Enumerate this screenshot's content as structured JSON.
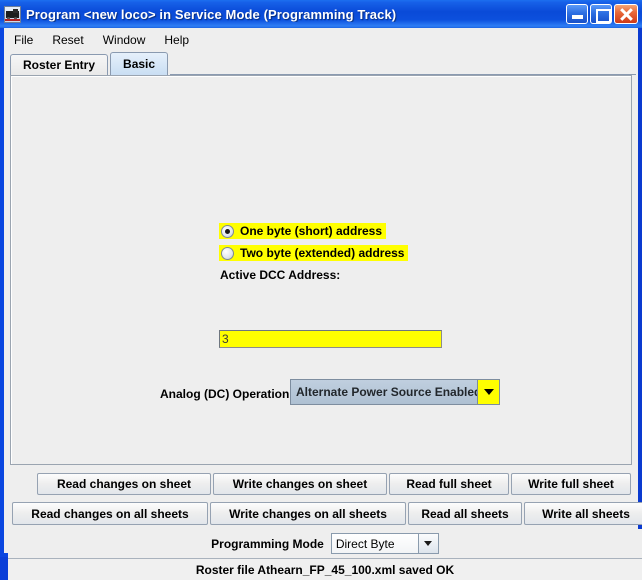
{
  "window": {
    "title": "Program <new loco> in Service Mode (Programming Track)",
    "icon": "locomotive-icon",
    "minimize_label": "",
    "maximize_label": "",
    "close_label": ""
  },
  "menubar": {
    "items": [
      {
        "label": "File"
      },
      {
        "label": "Reset"
      },
      {
        "label": "Window"
      },
      {
        "label": "Help"
      }
    ]
  },
  "tabs": [
    {
      "label": "Roster Entry",
      "selected": false
    },
    {
      "label": "Basic",
      "selected": true
    }
  ],
  "basic_panel": {
    "address_mode": {
      "options": [
        {
          "label": "One byte (short) address",
          "checked": true
        },
        {
          "label": "Two byte (extended) address",
          "checked": false
        }
      ]
    },
    "active_dcc_address": {
      "label": "Active DCC Address:",
      "value": "3",
      "placeholder": ""
    },
    "analog_operation": {
      "label": "Analog (DC) Operation",
      "value": "Alternate Power Source Enabled"
    }
  },
  "sheet_buttons": [
    {
      "label": "Read changes on sheet"
    },
    {
      "label": "Write changes on sheet"
    },
    {
      "label": "Read full sheet"
    },
    {
      "label": "Write full sheet"
    }
  ],
  "all_sheet_buttons": [
    {
      "label": "Read changes on all sheets"
    },
    {
      "label": "Write changes on all sheets"
    },
    {
      "label": "Read all sheets"
    },
    {
      "label": "Write all sheets"
    }
  ],
  "programming_mode": {
    "label": "Programming Mode",
    "value": "Direct Byte"
  },
  "statusbar": {
    "message": "Roster file Athearn_FP_45_100.xml saved OK"
  },
  "colors": {
    "titlebar_blue": "#0a4ad8",
    "highlight_yellow": "#ffff00",
    "panel_gray": "#eeeeee",
    "combo_blue_gray": "#b6c6d6",
    "selected_tab": "#c9def3"
  }
}
